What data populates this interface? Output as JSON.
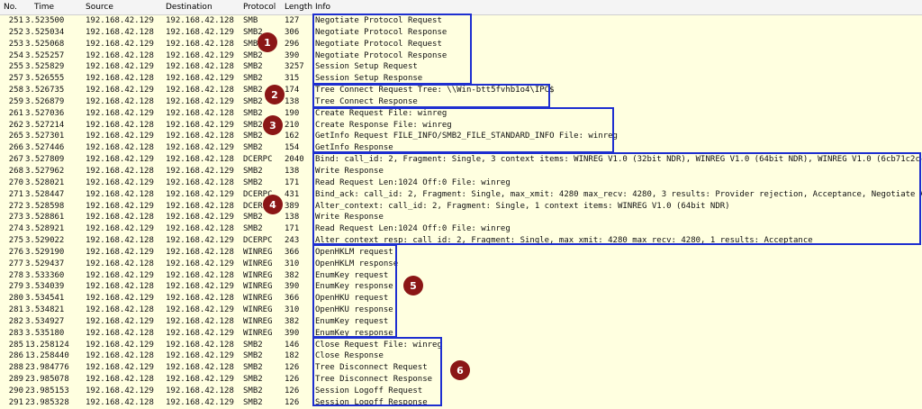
{
  "columns": {
    "no": "No.",
    "time": "Time",
    "source": "Source",
    "destination": "Destination",
    "protocol": "Protocol",
    "length": "Length",
    "info": "Info"
  },
  "rows": [
    {
      "no": "251",
      "time": "3.523500",
      "src": "192.168.42.129",
      "dst": "192.168.42.128",
      "proto": "SMB",
      "len": "127",
      "info": "Negotiate Protocol Request"
    },
    {
      "no": "252",
      "time": "3.525034",
      "src": "192.168.42.128",
      "dst": "192.168.42.129",
      "proto": "SMB2",
      "len": "306",
      "info": "Negotiate Protocol Response"
    },
    {
      "no": "253",
      "time": "3.525068",
      "src": "192.168.42.129",
      "dst": "192.168.42.128",
      "proto": "SMB2",
      "len": "296",
      "info": "Negotiate Protocol Request"
    },
    {
      "no": "254",
      "time": "3.525257",
      "src": "192.168.42.128",
      "dst": "192.168.42.129",
      "proto": "SMB2",
      "len": "390",
      "info": "Negotiate Protocol Response"
    },
    {
      "no": "255",
      "time": "3.525829",
      "src": "192.168.42.129",
      "dst": "192.168.42.128",
      "proto": "SMB2",
      "len": "3257",
      "info": "Session Setup Request"
    },
    {
      "no": "257",
      "time": "3.526555",
      "src": "192.168.42.128",
      "dst": "192.168.42.129",
      "proto": "SMB2",
      "len": "315",
      "info": "Session Setup Response"
    },
    {
      "no": "258",
      "time": "3.526735",
      "src": "192.168.42.129",
      "dst": "192.168.42.128",
      "proto": "SMB2",
      "len": "174",
      "info": "Tree Connect Request Tree: \\\\Win-btt5fvhb1o4\\IPC$"
    },
    {
      "no": "259",
      "time": "3.526879",
      "src": "192.168.42.128",
      "dst": "192.168.42.129",
      "proto": "SMB2",
      "len": "138",
      "info": "Tree Connect Response"
    },
    {
      "no": "261",
      "time": "3.527036",
      "src": "192.168.42.129",
      "dst": "192.168.42.128",
      "proto": "SMB2",
      "len": "190",
      "info": "Create Request File: winreg"
    },
    {
      "no": "262",
      "time": "3.527214",
      "src": "192.168.42.128",
      "dst": "192.168.42.129",
      "proto": "SMB2",
      "len": "210",
      "info": "Create Response File: winreg"
    },
    {
      "no": "265",
      "time": "3.527301",
      "src": "192.168.42.129",
      "dst": "192.168.42.128",
      "proto": "SMB2",
      "len": "162",
      "info": "GetInfo Request FILE_INFO/SMB2_FILE_STANDARD_INFO File: winreg"
    },
    {
      "no": "266",
      "time": "3.527446",
      "src": "192.168.42.128",
      "dst": "192.168.42.129",
      "proto": "SMB2",
      "len": "154",
      "info": "GetInfo Response"
    },
    {
      "no": "267",
      "time": "3.527809",
      "src": "192.168.42.129",
      "dst": "192.168.42.128",
      "proto": "DCERPC",
      "len": "2040",
      "info": "Bind: call_id: 2, Fragment: Single, 3 context items: WINREG V1.0 (32bit NDR), WINREG V1.0 (64bit NDR), WINREG V1.0 (6cb71c2c-98l"
    },
    {
      "no": "268",
      "time": "3.527962",
      "src": "192.168.42.128",
      "dst": "192.168.42.129",
      "proto": "SMB2",
      "len": "138",
      "info": "Write Response"
    },
    {
      "no": "270",
      "time": "3.528021",
      "src": "192.168.42.129",
      "dst": "192.168.42.128",
      "proto": "SMB2",
      "len": "171",
      "info": "Read Request Len:1024 Off:0 File: winreg"
    },
    {
      "no": "271",
      "time": "3.528447",
      "src": "192.168.42.128",
      "dst": "192.168.42.129",
      "proto": "DCERPC",
      "len": "431",
      "info": "Bind_ack: call_id: 2, Fragment: Single, max_xmit: 4280 max_recv: 4280, 3 results: Provider rejection, Acceptance, Negotiate ACK"
    },
    {
      "no": "272",
      "time": "3.528598",
      "src": "192.168.42.129",
      "dst": "192.168.42.128",
      "proto": "DCERPC",
      "len": "389",
      "info": "Alter_context: call_id: 2, Fragment: Single, 1 context items: WINREG V1.0 (64bit NDR)"
    },
    {
      "no": "273",
      "time": "3.528861",
      "src": "192.168.42.128",
      "dst": "192.168.42.129",
      "proto": "SMB2",
      "len": "138",
      "info": "Write Response"
    },
    {
      "no": "274",
      "time": "3.528921",
      "src": "192.168.42.129",
      "dst": "192.168.42.128",
      "proto": "SMB2",
      "len": "171",
      "info": "Read Request Len:1024 Off:0 File: winreg"
    },
    {
      "no": "275",
      "time": "3.529022",
      "src": "192.168.42.128",
      "dst": "192.168.42.129",
      "proto": "DCERPC",
      "len": "243",
      "info": "Alter_context_resp: call_id: 2, Fragment: Single, max_xmit: 4280 max_recv: 4280, 1 results: Acceptance"
    },
    {
      "no": "276",
      "time": "3.529190",
      "src": "192.168.42.129",
      "dst": "192.168.42.128",
      "proto": "WINREG",
      "len": "366",
      "info": "OpenHKLM request"
    },
    {
      "no": "277",
      "time": "3.529437",
      "src": "192.168.42.128",
      "dst": "192.168.42.129",
      "proto": "WINREG",
      "len": "310",
      "info": "OpenHKLM response"
    },
    {
      "no": "278",
      "time": "3.533360",
      "src": "192.168.42.129",
      "dst": "192.168.42.128",
      "proto": "WINREG",
      "len": "382",
      "info": "EnumKey request"
    },
    {
      "no": "279",
      "time": "3.534039",
      "src": "192.168.42.128",
      "dst": "192.168.42.129",
      "proto": "WINREG",
      "len": "390",
      "info": "EnumKey response"
    },
    {
      "no": "280",
      "time": "3.534541",
      "src": "192.168.42.129",
      "dst": "192.168.42.128",
      "proto": "WINREG",
      "len": "366",
      "info": "OpenHKU request"
    },
    {
      "no": "281",
      "time": "3.534821",
      "src": "192.168.42.128",
      "dst": "192.168.42.129",
      "proto": "WINREG",
      "len": "310",
      "info": "OpenHKU response"
    },
    {
      "no": "282",
      "time": "3.534927",
      "src": "192.168.42.129",
      "dst": "192.168.42.128",
      "proto": "WINREG",
      "len": "382",
      "info": "EnumKey request"
    },
    {
      "no": "283",
      "time": "3.535180",
      "src": "192.168.42.128",
      "dst": "192.168.42.129",
      "proto": "WINREG",
      "len": "390",
      "info": "EnumKey response"
    },
    {
      "no": "285",
      "time": "13.258124",
      "src": "192.168.42.129",
      "dst": "192.168.42.128",
      "proto": "SMB2",
      "len": "146",
      "info": "Close Request File: winreg"
    },
    {
      "no": "286",
      "time": "13.258440",
      "src": "192.168.42.128",
      "dst": "192.168.42.129",
      "proto": "SMB2",
      "len": "182",
      "info": "Close Response"
    },
    {
      "no": "288",
      "time": "23.984776",
      "src": "192.168.42.129",
      "dst": "192.168.42.128",
      "proto": "SMB2",
      "len": "126",
      "info": "Tree Disconnect Request"
    },
    {
      "no": "289",
      "time": "23.985078",
      "src": "192.168.42.128",
      "dst": "192.168.42.129",
      "proto": "SMB2",
      "len": "126",
      "info": "Tree Disconnect Response"
    },
    {
      "no": "290",
      "time": "23.985153",
      "src": "192.168.42.129",
      "dst": "192.168.42.128",
      "proto": "SMB2",
      "len": "126",
      "info": "Session Logoff Request"
    },
    {
      "no": "291",
      "time": "23.985328",
      "src": "192.168.42.128",
      "dst": "192.168.42.129",
      "proto": "SMB2",
      "len": "126",
      "info": "Session Logoff Response"
    }
  ],
  "annotations": {
    "box_color": "#1e2fd0",
    "marker_color": "#8b1616",
    "markers": [
      "1",
      "2",
      "3",
      "4",
      "5",
      "6"
    ]
  }
}
